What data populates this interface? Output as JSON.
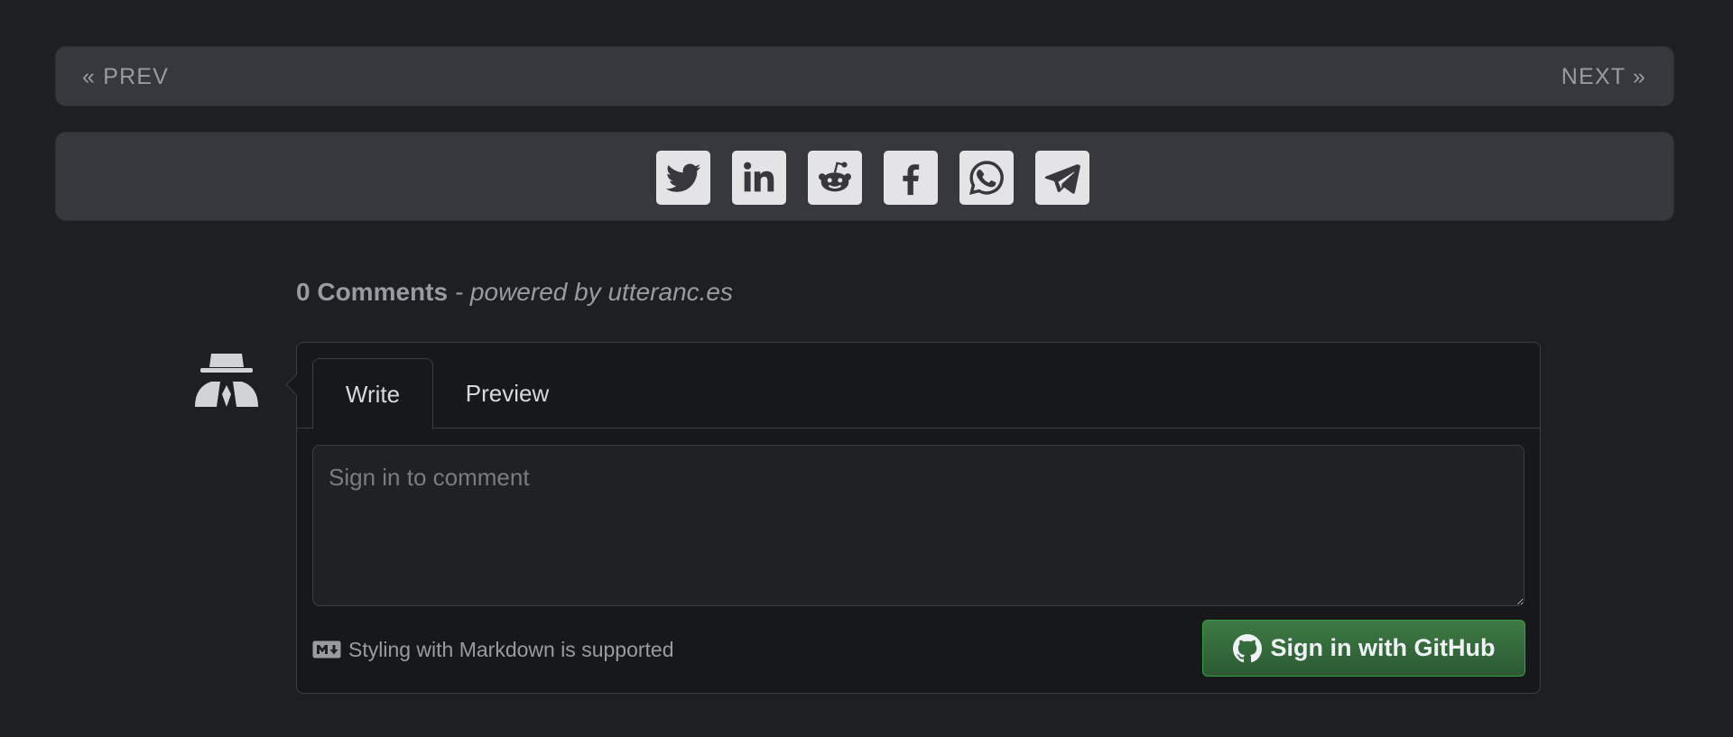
{
  "post_nav": {
    "prev_label": "« PREV",
    "next_label": "NEXT »"
  },
  "share": {
    "icons": [
      "twitter-icon",
      "linkedin-icon",
      "reddit-icon",
      "facebook-icon",
      "whatsapp-icon",
      "telegram-icon"
    ]
  },
  "comments": {
    "count_label": "0 Comments",
    "powered_label": " - powered by utteranc.es",
    "tabs": [
      {
        "label": "Write"
      },
      {
        "label": "Preview"
      }
    ],
    "textarea_placeholder": "Sign in to comment",
    "markdown_hint": "Styling with Markdown is supported",
    "signin_label": "Sign in with GitHub"
  },
  "colors": {
    "page_background": "#1e1f22",
    "bar_background": "#37383e",
    "signin_button": "#2b5a33",
    "share_icon_background": "#e4e4e6"
  }
}
